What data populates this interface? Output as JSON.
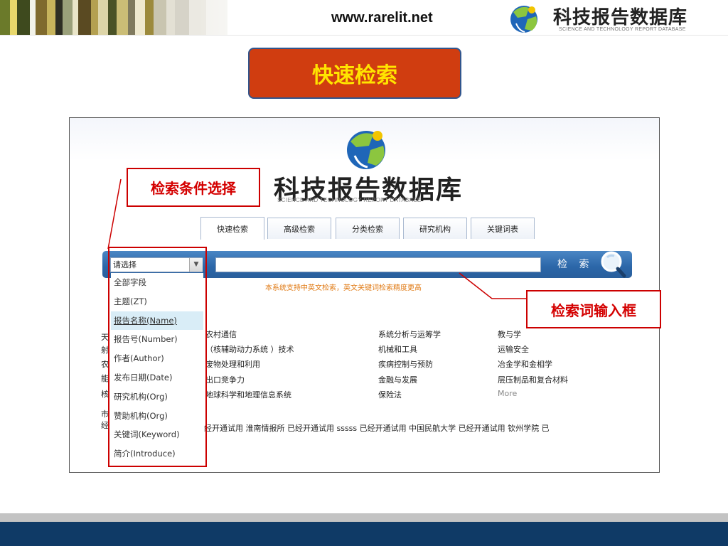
{
  "header": {
    "url": "www.rarelit.net",
    "logo_cn": "科技报告数据库",
    "logo_en": "SCIENCE AND TECHNOLOGY REPORT DATABASE",
    "logo_icon": "globe-logo-icon"
  },
  "slide_title": "快速检索",
  "inner": {
    "logo_cn": "科技报告数据库",
    "logo_en": "SCIENCE AND TECHNOLOGY REPORT DATABASE",
    "tabs": [
      {
        "label": "快速检索"
      },
      {
        "label": "高级检索"
      },
      {
        "label": "分类检索"
      },
      {
        "label": "研究机构"
      },
      {
        "label": "关键词表"
      }
    ],
    "search": {
      "select_value": "请选择",
      "input_value": "",
      "button_label": "检 索",
      "hint": "本系统支持中英文检索，英文关键词检索精度更高"
    },
    "dropdown_options": [
      {
        "label": "全部字段"
      },
      {
        "label": "主题(ZT)"
      },
      {
        "label": "报告名称(Name)"
      },
      {
        "label": "报告号(Number)"
      },
      {
        "label": "作者(Author)"
      },
      {
        "label": "发布日期(Date)"
      },
      {
        "label": "研究机构(Org)"
      },
      {
        "label": "赞助机构(Org)"
      },
      {
        "label": "关键词(Keyword)"
      },
      {
        "label": "简介(Introduce)"
      }
    ],
    "highlighted_option": "报告名称(Name)",
    "left_edge_chars": [
      "天",
      "射",
      "农",
      "能",
      "核",
      "市",
      "经"
    ],
    "categories": {
      "col1": [
        "农村通信",
        "（核辅助动力系统 ）技术",
        "废物处理和利用",
        "出口竞争力",
        "地球科学和地理信息系统"
      ],
      "col2": [
        "系统分析与运筹学",
        "机械和工具",
        "疾病控制与预防",
        "金融与发展",
        "保险法"
      ],
      "col3": [
        "教与学",
        "运输安全",
        "冶金学和金相学",
        "层压制品和复合材料",
        "More"
      ]
    },
    "trial_line": "经开通试用     淮南情报所 已经开通试用 sssss 已经开通试用 中国民航大学 已经开通试用 钦州学院 已"
  },
  "annotations": {
    "left": "检索条件选择",
    "right": "检索词输入框"
  },
  "colors": {
    "title_bg": "#d03d10",
    "title_text": "#ffe400",
    "annotation_red": "#cc0000",
    "search_bar_blue": "#2b66a8",
    "footer_blue": "#0f3a66"
  }
}
